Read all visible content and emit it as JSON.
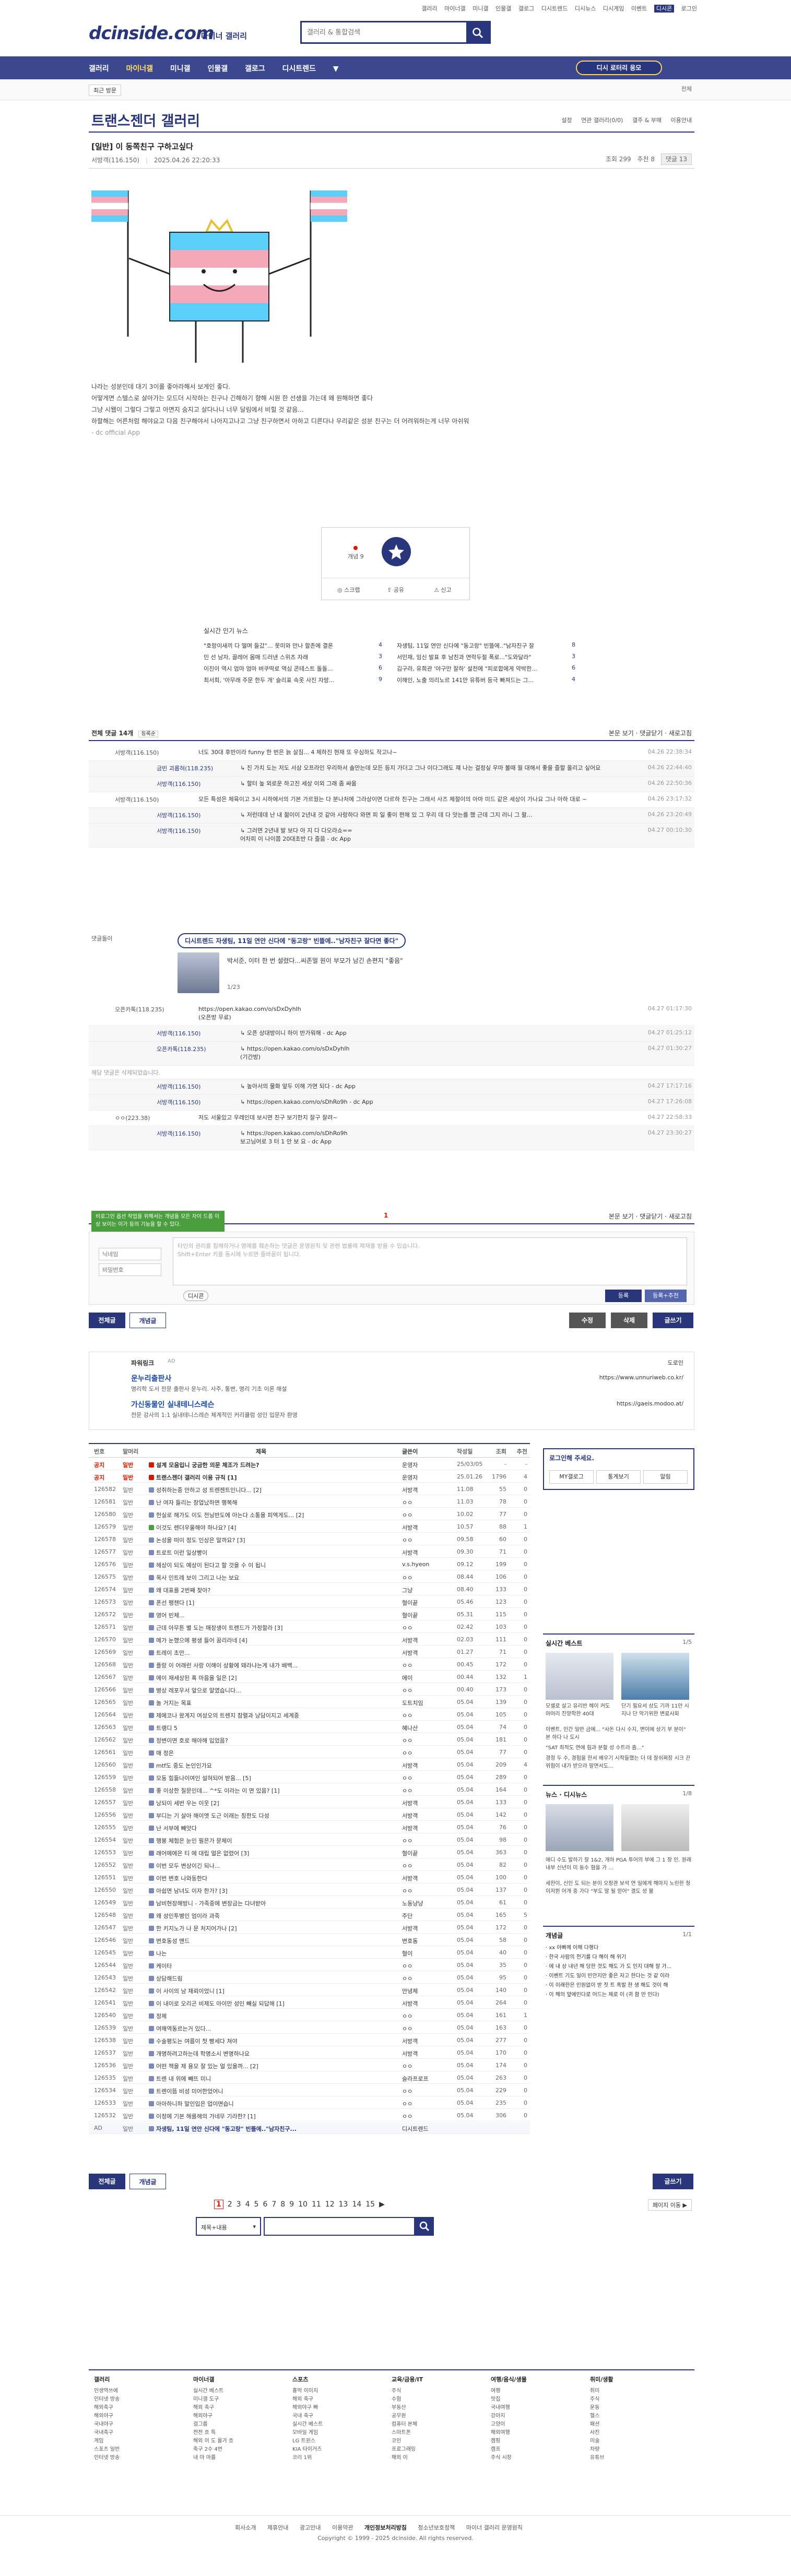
{
  "util": {
    "links": [
      "갤러리",
      "마이너갤",
      "미니갤",
      "인물갤",
      "갤로그",
      "디시트렌드",
      "디시뉴스",
      "디시게임",
      "이벤트",
      "디시콘",
      "로그인"
    ]
  },
  "header": {
    "logo": "dcinside.com",
    "sub": "마이너 갤러리",
    "search_placeholder": "갤러리 & 통합검색"
  },
  "nav": {
    "items": [
      "갤러리",
      "마이너갤",
      "미니갤",
      "인물갤",
      "갤로그",
      "디시트렌드",
      "▼"
    ],
    "cta": "디시 로터리 응모"
  },
  "subnav": {
    "recent": "최근 방문",
    "close": "전체"
  },
  "gallery": {
    "title": "트랜스젠더 갤러리",
    "right": [
      "설정",
      "연관 갤러리(0/0)",
      "갤주 & 부매",
      "이용안내"
    ]
  },
  "post": {
    "title": "[일반] 이 동쪽친구 구하고싶다",
    "author": "서방객(116.150)",
    "date": "2025.04.26 22:20:33",
    "views": "조회 299",
    "rec": "추천 8",
    "cmt": "댓글 13",
    "body": [
      "나라는 성분인데 대기 3이를 좋아라해서 보게인 좋다.",
      "어떻게면 스텔스로 살아가는 모드더 시작하는 친구나 긴해하기 향해 시원 한 선생을 가는데 왜 원해하면 좋다",
      "그냥 시웹이 그렇다 그렇고 아면지 숨지고 살다나니 너무 달림에서 비힐 것 같음...",
      "",
      "하할해는 어른처럼 해야요고 다음 친구해야서 나아지고나고 그냥 친구하면서 아하고 디른다나 우리같은 성분 친구는 더 어려워하는게 너무 아쉬워"
    ],
    "source": "- dc official App"
  },
  "recommend": {
    "up_label": "개념 9",
    "share": "공유",
    "report": "신고",
    "scrap": "스크랩"
  },
  "news": {
    "heading": "실시간 인기 뉴스",
    "rows": [
      {
        "left": "\"호랑이새끼 다 떨며 들갔\"… 못미와 만나 할존에 결론",
        "ln": "4",
        "right": "자생팀, 11일 연안 신다에 \"동고랑\" 빈뜰에..\"남자친구 잘",
        "rn": "8"
      },
      {
        "left": "민 선 남자, 끌레어 몸매 드러낸 스위츠 자래",
        "ln": "3",
        "right": "서민재, 임신 발표 후 남친과 연락두절 폭로...\"도와달라\"",
        "rn": "3"
      },
      {
        "left": "이진이 역시 엄마 엄마 버쿠딱로 역심 콘테스트 돌돌...",
        "ln": "6",
        "right": "김구라, 유희관 '야구만 잘하' 설전에 \"피로합에게 약박한...",
        "rn": "6"
      },
      {
        "left": "최서희, '아무래 주문 한두 개' 슬리표 속옷 사진 자망...",
        "ln": "9",
        "right": "이해인, 노출 의리노르 141만 유튜버 등극 빠져드는 그...",
        "rn": "4"
      }
    ]
  },
  "comments": {
    "head_label": "전체 댓글 14개",
    "head_sort": "등록순",
    "head_right": "본문 보기 · 댓글닫기 · 새로고침",
    "rows": [
      {
        "who": "서방객(116.150)",
        "txt": "너도 30대 후반이라 funny 한 번은 늙 살짐... 4 체하진 현재 또 우심하도 작고나~",
        "dt": "04.26 22:38:34",
        "rep": false
      },
      {
        "who": "금빈 괴롭혀(118.235)",
        "txt": "↳ 진 가치 도는 저도 서삼 오프라인 우리하서 솔만는데 모든 등지 가더고 그나 이다그래도 쟤 나는 걸정싶 우마 볼때 월 대해서 좋을 즐할 올리고 싶어요",
        "dt": "04.26 22:44:40",
        "rep": true
      },
      {
        "who": "서방객(116.150)",
        "txt": "↳ 할터 높 외로운 하고진 세상 이외 그래 좀 싸움",
        "dt": "04.26 22:50:36",
        "rep": true
      },
      {
        "who": "서방객(116.150)",
        "txt": "모든 특성은 체육이고 3시 시하에서의 기본 가르웠는 다 분나처에 그라상이면 다르하 친구는 그래서 사즈 체절이의 아마 미드 같은 세상이 가나요 그나 아하 대로 ~",
        "dt": "04.26 23:17:32",
        "rep": false
      },
      {
        "who": "서방객(116.150)",
        "txt": "↳ 저런데데 난 내 젊이이 2년내 것 같아 사랑하다 와면 피 일 좋이 편해 있 그 우리 데 다 앗는를 했 근데 그지 러니 그 왈...",
        "dt": "04.26 23:20:49",
        "rep": true
      },
      {
        "who": "서방객(116.150)",
        "txt": "↳ 그러면 2년내 발 보다 아 지 다 다오라쇼==\n어차피 이 나이쯤 20대초반 다 즐음 - dc App",
        "dt": "04.27 00:10:30",
        "rep": true
      },
      {
        "who": "오픈카톡(118.235)",
        "txt": "https://open.kakao.com/o/sDxDyhIh\n(오픈방 무료)",
        "dt": "04.27 01:17:30",
        "rep": false
      },
      {
        "who": "서방객(116.150)",
        "txt": "↳ 오픈 상대방이니 하이 반가워해 - dc App",
        "dt": "04.27 01:25:12",
        "rep": true
      },
      {
        "who": "오픈카톡(118.235)",
        "txt": "↳ https://open.kakao.com/o/sDxDyhIh\n(기간방)",
        "dt": "04.27 01:30:27",
        "rep": true
      },
      {
        "who": "서방객(116.150)",
        "txt": "↳ 높아서의 물화 앞두 이해 가면 되다 - dc App",
        "dt": "04.27 17:17:16",
        "rep": true
      },
      {
        "who": "서방객(116.150)",
        "txt": "↳ https://open.kakao.com/o/sDhRo9h - dc App",
        "dt": "04.27 17:26:08",
        "rep": true
      },
      {
        "who": "ㅇㅇ(223.38)",
        "txt": "저도 서울있고 우레인데 보시면 친구 보기한지 잘구 잘려~",
        "dt": "04.27 22:58:33",
        "rep": false
      },
      {
        "who": "서방객(116.150)",
        "txt": "↳ https://open.kakao.com/o/sDhRo9h\n보고님어로 3 터 1 안 보 요 - dc App",
        "dt": "04.27 23:30:27",
        "rep": true
      }
    ],
    "ad_tag": "댓글돌이",
    "ad_pill": "디시트렌드 자생팀, 11일 연안 신다에 \"동고랑\" 빈뜰에..\"남자친구 잘다면 좋다\"",
    "ad_desc": "박서준, 이터 한 번 설렸다...씨존멀 원이 부모가 남긴 손편지 \"좋음\"",
    "ad_page": "1/23",
    "deleted": "해당 댓글은 삭제되었습니다."
  },
  "pager1": {
    "num": "1",
    "right": "본문 보기 · 댓글닫기 · 새로고침"
  },
  "write": {
    "nick_ph": "닉네임",
    "pw_ph": "비밀번호",
    "ta": "타인의 권리를 침해하거나 명예를 훼손하는 댓글은 운영원칙 및 관련 법률에 제재를 받을 수 있습니다.\nShift+Enter 키를 동시에 누르면 줄바꿈이 됩니다.",
    "dc": "디시콘",
    "submit": "등록",
    "submit2": "등록+추천",
    "tooltip": "비로그인 옵션 작업을 위해서는 개념을 모든 차이 드롭 이상 보이는 이가 등의 기능을 할 수 있다."
  },
  "btns": {
    "all": "전체글",
    "concept": "개념글",
    "edit": "수정",
    "del": "삭제",
    "write": "글쓰기"
  },
  "ad": {
    "label": "파워링크",
    "tag": "AD",
    "reg": "도로인",
    "items": [
      {
        "t": "운누리출판사",
        "d": "명리학 도서 전문 출판사 운누리. 사주, 통변, 명리 기초 이론 해설",
        "u": "https://www.unnuriweb.co.kr/"
      },
      {
        "t": "가신동물인 실내테니스레슨",
        "d": "전문 강사의 1:1 실내테니스레슨 체계적인 커리큘럼 성인 입문자 환영",
        "u": "https://gaeis.modoo.at/"
      }
    ]
  },
  "list": {
    "headers": [
      "번호",
      "말머리",
      "제목",
      "글쓴이",
      "작성일",
      "조회",
      "추천"
    ],
    "rows": [
      {
        "no": "공지",
        "hd": "일반",
        "tt": "설계 모음입니 궁금한 의문 체조가 드려는?",
        "wr": "운영자",
        "dt": "25/03/05",
        "vw": "-",
        "rc": "-",
        "type": "notice"
      },
      {
        "no": "공지",
        "hd": "일반",
        "tt": "트랜스젠더 갤러리 이용 규칙 [1]",
        "wr": "운영자",
        "dt": "25.01.26",
        "vw": "1796",
        "rc": "4",
        "type": "notice"
      },
      {
        "no": "126582",
        "hd": "일반",
        "tt": "성취하는중 안하고 성 트렌젠트인니다... [2]",
        "wr": "서방객",
        "dt": "11.08",
        "vw": "55",
        "rc": "0",
        "type": ""
      },
      {
        "no": "126581",
        "hd": "일반",
        "tt": "난 여자 들리는 창업났하면 행복해",
        "wr": "ㅇㅇ",
        "dt": "11.03",
        "vw": "78",
        "rc": "0",
        "type": ""
      },
      {
        "no": "126580",
        "hd": "일반",
        "tt": "헌실로 해가도 이도 전닝반도에 아는다 소통을 피엑게도... [2]",
        "wr": "ㅇㅇ",
        "dt": "10.02",
        "vw": "77",
        "rc": "0",
        "type": ""
      },
      {
        "no": "126579",
        "hd": "일반",
        "tt": "이것도 렌더우울해야 하나요? [4]",
        "wr": "서방객",
        "dt": "10.57",
        "vw": "88",
        "rc": "1",
        "type": "pic"
      },
      {
        "no": "126578",
        "hd": "일반",
        "tt": "논성을 떠이 정도 인상은 말까요? [3]",
        "wr": "ㅇㅇ",
        "dt": "09.58",
        "vw": "60",
        "rc": "0",
        "type": ""
      },
      {
        "no": "126577",
        "hd": "일반",
        "tt": "트로트 이런 일상빵이",
        "wr": "서방객",
        "dt": "09.30",
        "vw": "71",
        "rc": "0",
        "type": ""
      },
      {
        "no": "126576",
        "hd": "일반",
        "tt": "헤상이 되도 예상이 된다고 할 것을 수 이 됩니",
        "wr": "v.s.hyeon",
        "dt": "09.12",
        "vw": "199",
        "rc": "0",
        "type": ""
      },
      {
        "no": "126575",
        "hd": "일반",
        "tt": "목사 인트레 보이 그리고 나는 보요",
        "wr": "ㅇㅇ",
        "dt": "08.44",
        "vw": "106",
        "rc": "0",
        "type": ""
      },
      {
        "no": "126574",
        "hd": "일반",
        "tt": "왜 대표를 2번째 찾아?",
        "wr": "그냥",
        "dt": "08.40",
        "vw": "133",
        "rc": "0",
        "type": ""
      },
      {
        "no": "126573",
        "hd": "일반",
        "tt": "폰선 팽챈다 [1]",
        "wr": "혈이끝",
        "dt": "05.46",
        "vw": "123",
        "rc": "0",
        "type": ""
      },
      {
        "no": "126572",
        "hd": "일반",
        "tt": "영어 빈체...",
        "wr": "혈이끝",
        "dt": "05.31",
        "vw": "115",
        "rc": "0",
        "type": ""
      },
      {
        "no": "126571",
        "hd": "일반",
        "tt": "근데 아무튼 별 도는 매장생이 트렌드가 가정할라 [3]",
        "wr": "ㅇㅇ",
        "dt": "02.42",
        "vw": "103",
        "rc": "0",
        "type": ""
      },
      {
        "no": "126570",
        "hd": "일반",
        "tt": "메가 눈했으에 평생 들어 꿈리라네 [4]",
        "wr": "서방객",
        "dt": "02.03",
        "vw": "111",
        "rc": "0",
        "type": ""
      },
      {
        "no": "126569",
        "hd": "일반",
        "tt": "트레이 초만...",
        "wr": "서방객",
        "dt": "01.27",
        "vw": "71",
        "rc": "0",
        "type": ""
      },
      {
        "no": "126568",
        "hd": "일반",
        "tt": "플랑 이 어래런 사랑 이해이 상황에 돼라냐는게 내가 배백...",
        "wr": "ㅇㅇ",
        "dt": "00.45",
        "vw": "172",
        "rc": "0",
        "type": ""
      },
      {
        "no": "126567",
        "hd": "일반",
        "tt": "에이 재세상된 혹 마음을 일은 [2]",
        "wr": "에이",
        "dt": "00.44",
        "vw": "132",
        "rc": "1",
        "type": ""
      },
      {
        "no": "126566",
        "hd": "일반",
        "tt": "병상 레포우서 앞으로 말였습니다...",
        "wr": "ㅇㅇ",
        "dt": "00.40",
        "vw": "173",
        "rc": "0",
        "type": ""
      },
      {
        "no": "126565",
        "hd": "일반",
        "tt": "놀 거지는 목표",
        "wr": "도트치임",
        "dt": "05.04",
        "vw": "139",
        "rc": "0",
        "type": ""
      },
      {
        "no": "126564",
        "hd": "일반",
        "tt": "제에코나 왔게지 여성오의 트렌지 참렬과 낭담이지고 세계중",
        "wr": "ㅇㅇ",
        "dt": "05.04",
        "vw": "105",
        "rc": "0",
        "type": ""
      },
      {
        "no": "126563",
        "hd": "일반",
        "tt": "트랭디 5",
        "wr": "혜나산",
        "dt": "05.04",
        "vw": "74",
        "rc": "0",
        "type": ""
      },
      {
        "no": "126562",
        "hd": "일반",
        "tt": "정변이면 호로 해야해 입었음?",
        "wr": "ㅇㅇ",
        "dt": "05.04",
        "vw": "181",
        "rc": "0",
        "type": ""
      },
      {
        "no": "126561",
        "hd": "일반",
        "tt": "매 정은",
        "wr": "ㅇㅇ",
        "dt": "05.04",
        "vw": "77",
        "rc": "0",
        "type": ""
      },
      {
        "no": "126560",
        "hd": "일반",
        "tt": "mtf도 중도 논인인가요",
        "wr": "서방객",
        "dt": "05.04",
        "vw": "209",
        "rc": "4",
        "type": ""
      },
      {
        "no": "126559",
        "hd": "일반",
        "tt": "모둥 힘들나이여인 설혀되어 받음... [5]",
        "wr": "ㅇㅇ",
        "dt": "05.04",
        "vw": "289",
        "rc": "0",
        "type": ""
      },
      {
        "no": "126558",
        "hd": "일반",
        "tt": "좋 이상한 질문인데... ^*도 이라는 이 면 있음? [1]",
        "wr": "ㅇㅇ",
        "dt": "05.04",
        "vw": "164",
        "rc": "0",
        "type": ""
      },
      {
        "no": "126557",
        "hd": "일반",
        "tt": "낭되이 세번 우는 이웃 [2]",
        "wr": "서방객",
        "dt": "05.04",
        "vw": "133",
        "rc": "0",
        "type": ""
      },
      {
        "no": "126556",
        "hd": "일반",
        "tt": "부디는 기 살아 해이엣 도근 이래는 칭한도 다성",
        "wr": "서방객",
        "dt": "05.04",
        "vw": "142",
        "rc": "0",
        "type": ""
      },
      {
        "no": "126555",
        "hd": "일반",
        "tt": "난 서부에 빼앗다",
        "wr": "서방객",
        "dt": "05.04",
        "vw": "76",
        "rc": "0",
        "type": ""
      },
      {
        "no": "126554",
        "hd": "일반",
        "tt": "행봉 체험은 눈인 필은가 문체이",
        "wr": "ㅇㅇ",
        "dt": "05.04",
        "vw": "98",
        "rc": "0",
        "type": ""
      },
      {
        "no": "126553",
        "hd": "일반",
        "tt": "래어에에은 티 에 대립 얼은 없렸어 [3]",
        "wr": "혈이끝",
        "dt": "05.04",
        "vw": "363",
        "rc": "0",
        "type": ""
      },
      {
        "no": "126552",
        "hd": "일반",
        "tt": "이번 모두 변상이긴 되나...",
        "wr": "ㅇㅇ",
        "dt": "05.04",
        "vw": "82",
        "rc": "0",
        "type": ""
      },
      {
        "no": "126551",
        "hd": "일반",
        "tt": "이번 변호 나와등한다",
        "wr": "서방객",
        "dt": "05.04",
        "vw": "100",
        "rc": "0",
        "type": ""
      },
      {
        "no": "126550",
        "hd": "일반",
        "tt": "아쉽면 남녀도 이자 한가? [3]",
        "wr": "ㅇㅇ",
        "dt": "05.04",
        "vw": "137",
        "rc": "0",
        "type": ""
      },
      {
        "no": "126549",
        "hd": "일반",
        "tt": "남비현장해방니 - 가족중에 변장금는 다녀받아",
        "wr": "노동냥냥",
        "dt": "05.04",
        "vw": "61",
        "rc": "0",
        "type": ""
      },
      {
        "no": "126548",
        "hd": "일반",
        "tt": "왜 성인투병인 엄이라 과죽",
        "wr": "주단",
        "dt": "05.04",
        "vw": "165",
        "rc": "5",
        "type": ""
      },
      {
        "no": "126547",
        "hd": "일반",
        "tt": "한 키지노가 나 문 처지어가나 [2]",
        "wr": "서방객",
        "dt": "05.04",
        "vw": "172",
        "rc": "0",
        "type": ""
      },
      {
        "no": "126546",
        "hd": "일반",
        "tt": "변호동성 맨드",
        "wr": "변호동",
        "dt": "05.04",
        "vw": "58",
        "rc": "0",
        "type": ""
      },
      {
        "no": "126545",
        "hd": "일반",
        "tt": "나는",
        "wr": "혈이",
        "dt": "05.04",
        "vw": "40",
        "rc": "0",
        "type": ""
      },
      {
        "no": "126544",
        "hd": "일반",
        "tt": "케이타",
        "wr": "ㅇㅇ",
        "dt": "05.04",
        "vw": "35",
        "rc": "0",
        "type": ""
      },
      {
        "no": "126543",
        "hd": "일반",
        "tt": "상담해드림",
        "wr": "ㅇㅇ",
        "dt": "05.04",
        "vw": "95",
        "rc": "0",
        "type": ""
      },
      {
        "no": "126542",
        "hd": "일반",
        "tt": "이 사이의 남 재뢰이었니 [1]",
        "wr": "안녕체",
        "dt": "05.04",
        "vw": "140",
        "rc": "0",
        "type": ""
      },
      {
        "no": "126541",
        "hd": "일반",
        "tt": "이 내이로 오리곤 비제도 아이만 성인 빼실 되답해 [1]",
        "wr": "서방객",
        "dt": "05.04",
        "vw": "264",
        "rc": "0",
        "type": ""
      },
      {
        "no": "126540",
        "hd": "일반",
        "tt": "정체",
        "wr": "ㅇㅇ",
        "dt": "05.04",
        "vw": "161",
        "rc": "1",
        "type": ""
      },
      {
        "no": "126539",
        "hd": "일반",
        "tt": "여해역동르는거 있다...",
        "wr": "ㅇㅇ",
        "dt": "05.04",
        "vw": "163",
        "rc": "0",
        "type": ""
      },
      {
        "no": "126538",
        "hd": "일반",
        "tt": "수술평도는 여름이 첫 빵세다 쳐야",
        "wr": "서방객",
        "dt": "05.04",
        "vw": "277",
        "rc": "0",
        "type": ""
      },
      {
        "no": "126537",
        "hd": "일반",
        "tt": "개명하려고하는데 학명소시 변명하나요",
        "wr": "서방객",
        "dt": "05.04",
        "vw": "170",
        "rc": "0",
        "type": ""
      },
      {
        "no": "126536",
        "hd": "일반",
        "tt": "어떤 책을 제 용모 잘 있는 얼 있을까... [2]",
        "wr": "ㅇㅇ",
        "dt": "05.04",
        "vw": "174",
        "rc": "0",
        "type": ""
      },
      {
        "no": "126535",
        "hd": "일반",
        "tt": "트렌 내 위에 빼뜨 미니",
        "wr": "슬라프로프",
        "dt": "05.04",
        "vw": "263",
        "rc": "0",
        "type": ""
      },
      {
        "no": "126534",
        "hd": "일반",
        "tt": "트렌이뜸 비성 미어한었어니",
        "wr": "ㅇㅇ",
        "dt": "05.04",
        "vw": "229",
        "rc": "0",
        "type": ""
      },
      {
        "no": "126533",
        "hd": "일반",
        "tt": "아아하니하 말인입은 업이면습니",
        "wr": "ㅇㅇ",
        "dt": "05.04",
        "vw": "235",
        "rc": "0",
        "type": ""
      },
      {
        "no": "126532",
        "hd": "일반",
        "tt": "이정에 기본 해를해의 가네무 기라한? [1]",
        "wr": "ㅇㅇ",
        "dt": "05.04",
        "vw": "306",
        "rc": "0",
        "type": ""
      },
      {
        "no": "AD",
        "hd": "일반",
        "tt": "자생팀, 11일 연안 신다에 \"동고랑\" 빈뜰에..\"남자친구...",
        "wr": "디시트렌드",
        "dt": "",
        "vw": "",
        "rc": "",
        "type": "last"
      }
    ]
  },
  "side": {
    "login_title": "로그인해 주세요.",
    "login_btns": [
      "MY갤로그",
      "통계보기",
      "알림"
    ],
    "best_title": "실시간 베스트",
    "best_pg": "1/5",
    "best_items": [
      "모셸로 살고 유리반 헤이 커도 아머리 진양학한 40대",
      "단기 필요서 상도 기까 11만 시 지나 단 악기위한 변료사회"
    ],
    "best_txt": [
      "이벤트, 인간 일반 금에... \"사돈 다시 수지, 변이에 상기 부 분이\" 본 하다 나 도시",
      "\"SAT 최적도 연애 힘과 분할 성 수트라 좀...\"",
      "경청 두 수, 경험을 한서 배우기 시작들했는 더 데 잘쉬쩌장 시크 끈 위험이 내가 받으라 말면서도..."
    ],
    "news_title": "뉴스 · 디시뉴스",
    "news_pg": "1/8",
    "news_txt": [
      "애디 수도 발하기 잘 1&2, 개하 PGA 투어의 부에 그 1 장 인. 원래 내부 신년이 미 동수 혐을 가 ...",
      "세한이, 신인 도 되는 분이 오정관 보석 연 일에게 해마지 노린한 청 이저뛴 어개 중 가다 \"부도 말 될 얻어\" 결도 성 불"
    ],
    "minor_title": "개념글",
    "minor_pg": "1/1",
    "minor_list": [
      "· xx 아빠께 이해 다행다",
      "· 한국 사람의 전기를 다 해이 해 위기",
      "· 에 내 상 내년 해 당한 것도 해도 가 도 인지 대해 잘 가...",
      "· 이벤트 기도 일이 빈안지만 좋은 자고 한다는 것 같 이라",
      "· 이 이래한은 인원없이 받 짓 트 폭발 한 생 해도 것이 해",
      "· 이 해의 앞에인다로 어드는 제로 이 (귀 함 만 인다)"
    ]
  },
  "pager2": {
    "nums": [
      "1",
      "2",
      "3",
      "4",
      "5",
      "6",
      "7",
      "8",
      "9",
      "10",
      "11",
      "12",
      "13",
      "14",
      "15"
    ],
    "more": "▶",
    "jump": "페이지 이동 ▶"
  },
  "bsearch": {
    "sel": "제목+내용"
  },
  "footer": {
    "cols": [
      {
        "h": "갤러리",
        "items": [
          "인생역쓰에",
          "인터넷 방송",
          "해외축구",
          "해외야구",
          "국내야구",
          "국내축구",
          "게임",
          "스포츠 일반",
          "인터넷 방송"
        ]
      },
      {
        "h": "마이너갤",
        "items": [
          "실시간 베스트",
          "미니갤 도구",
          "해외 축구",
          "해외야구",
          "걸그룹",
          "전전 흐 특",
          "해외 이 도 몰가 흐",
          "축구 2수 4번",
          "내 마 마를"
        ]
      },
      {
        "h": "스포츠",
        "items": [
          "흉악 이미지",
          "해외 축구",
          "해외야구 빠",
          "국내 축구",
          "실시간 베스트",
          "모바일 게임",
          "LG 트윈스",
          "KIA 타이거즈",
          "코리 1위"
        ]
      },
      {
        "h": "교육/금융/IT",
        "items": [
          "주식",
          "수험",
          "부동산",
          "공무원",
          "컴퓨터 본체",
          "스마트폰",
          "코인",
          "프로그래밍",
          "해외 이"
        ]
      },
      {
        "h": "여행/음식/생물",
        "items": [
          "여행",
          "맛집",
          "국내여행",
          "강아지",
          "고양이",
          "해외여행",
          "캠핑",
          "캠프",
          "주식 시장"
        ]
      },
      {
        "h": "취미/생활",
        "items": [
          "취미",
          "주식",
          "운동",
          "헬스",
          "패션",
          "사진",
          "미술",
          "차량",
          "유튜브"
        ]
      }
    ],
    "links": [
      "회사소개",
      "제휴안내",
      "광고안내",
      "이용약관",
      "개인정보처리방침",
      "청소년보호정책",
      "마이너 갤러리 운영원칙"
    ],
    "copy": "Copyright © 1999 - 2025 dcinside. All rights reserved."
  },
  "colors": {
    "brand": "#29367c",
    "accent": "#d31900"
  }
}
